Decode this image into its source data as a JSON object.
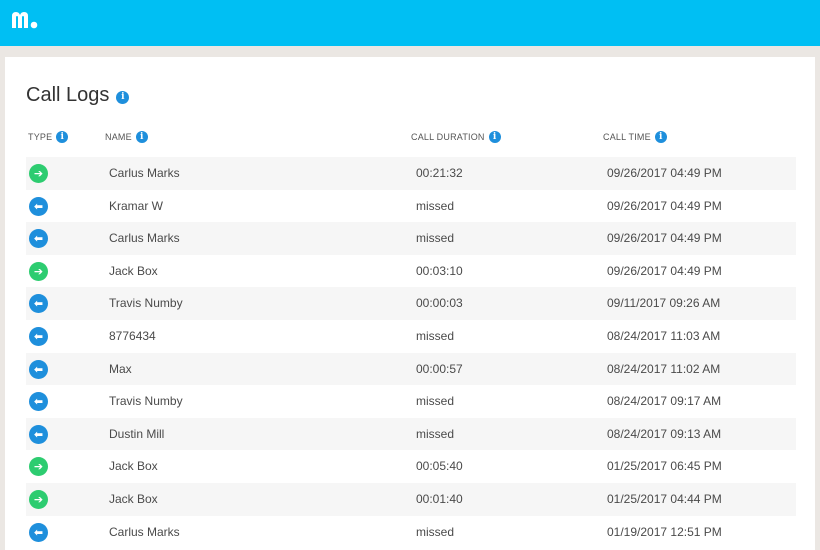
{
  "header": {
    "logo_icon": "mspy-logo-icon",
    "bar_color": "#00bff3"
  },
  "page": {
    "title": "Call Logs",
    "title_info_icon": "info-icon"
  },
  "table": {
    "columns": [
      "TYPE",
      "NAME",
      "CALL DURATION",
      "CALL TIME"
    ],
    "rows": [
      {
        "type": "outgoing",
        "name": "Carlus Marks",
        "duration": "00:21:32",
        "time": "09/26/2017 04:49 PM"
      },
      {
        "type": "incoming",
        "name": "Kramar W",
        "duration": "missed",
        "time": "09/26/2017 04:49 PM"
      },
      {
        "type": "incoming",
        "name": "Carlus Marks",
        "duration": "missed",
        "time": "09/26/2017 04:49 PM"
      },
      {
        "type": "outgoing",
        "name": "Jack Box",
        "duration": "00:03:10",
        "time": "09/26/2017 04:49 PM"
      },
      {
        "type": "incoming",
        "name": "Travis Numby",
        "duration": "00:00:03",
        "time": "09/11/2017 09:26 AM"
      },
      {
        "type": "incoming",
        "name": "8776434",
        "duration": "missed",
        "time": "08/24/2017 11:03 AM"
      },
      {
        "type": "incoming",
        "name": "Max",
        "duration": "00:00:57",
        "time": "08/24/2017 11:02 AM"
      },
      {
        "type": "incoming",
        "name": "Travis Numby",
        "duration": "missed",
        "time": "08/24/2017 09:17 AM"
      },
      {
        "type": "incoming",
        "name": "Dustin Mill",
        "duration": "missed",
        "time": "08/24/2017 09:13 AM"
      },
      {
        "type": "outgoing",
        "name": "Jack Box",
        "duration": "00:05:40",
        "time": "01/25/2017 06:45 PM"
      },
      {
        "type": "outgoing",
        "name": "Jack Box",
        "duration": "00:01:40",
        "time": "01/25/2017 04:44 PM"
      },
      {
        "type": "incoming",
        "name": "Carlus Marks",
        "duration": "missed",
        "time": "01/19/2017 12:51 PM"
      }
    ]
  },
  "colors": {
    "outgoing": "#2dcc70",
    "incoming": "#1e8fdc",
    "info": "#1e8fdc"
  }
}
